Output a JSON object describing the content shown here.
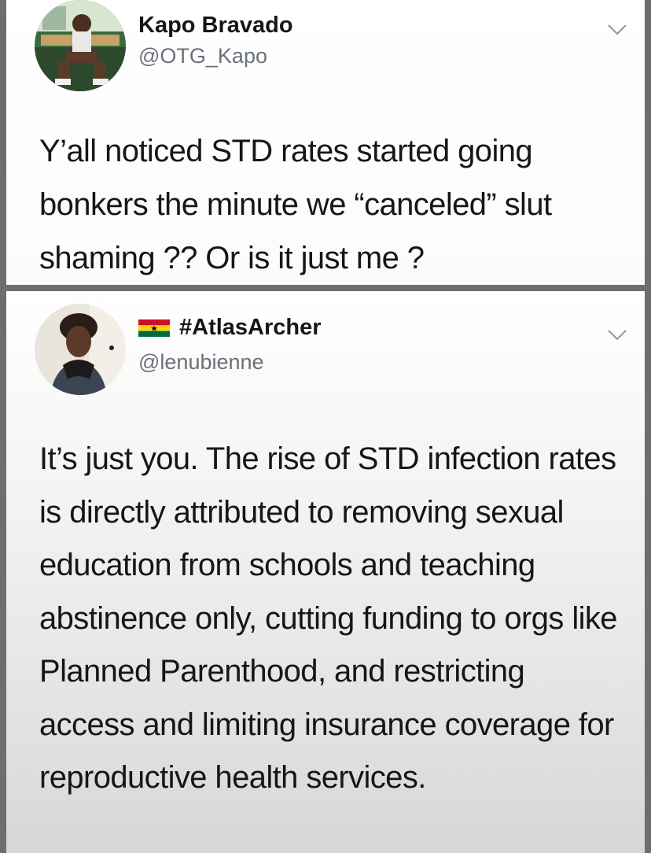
{
  "tweets": [
    {
      "display_name": "Kapo Bravado",
      "handle": "@OTG_Kapo",
      "text": "Y’all noticed STD rates started going bonkers the minute we “canceled” slut shaming ?? Or is it just me ?",
      "avatar_icon": "profile-photo"
    },
    {
      "display_name": "#AtlasArcher",
      "handle": "@lenubienne",
      "flag_icon": "ghana-flag-icon",
      "text": "It’s just you. The rise of STD infection rates is directly attributed to removing sexual education from schools and teaching abstinence only, cutting funding to orgs like Planned Parenthood, and restricting access and limiting insurance coverage for reproductive health services.",
      "avatar_icon": "profile-photo"
    }
  ],
  "colors": {
    "name": "#14171a",
    "handle": "#6a7178",
    "chevron": "#8899a6",
    "separator": "#6e6e6e"
  }
}
